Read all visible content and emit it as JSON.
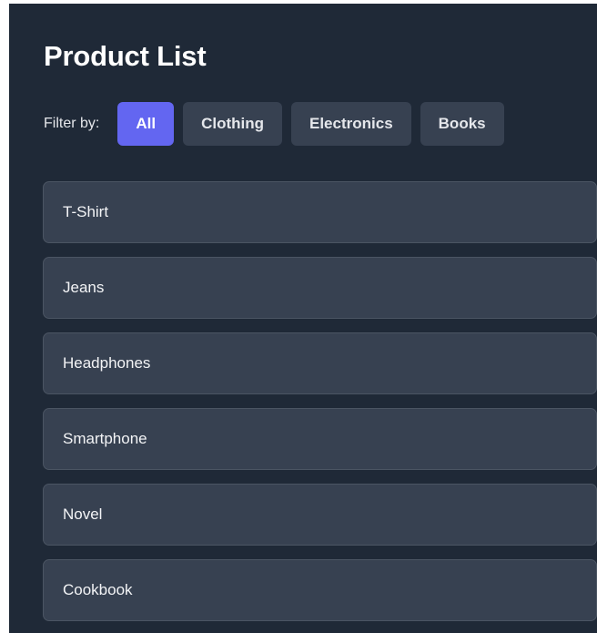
{
  "page": {
    "title": "Product List"
  },
  "filters": {
    "label": "Filter by:",
    "options": [
      {
        "label": "All",
        "active": true
      },
      {
        "label": "Clothing",
        "active": false
      },
      {
        "label": "Electronics",
        "active": false
      },
      {
        "label": "Books",
        "active": false
      }
    ]
  },
  "products": [
    {
      "name": "T-Shirt"
    },
    {
      "name": "Jeans"
    },
    {
      "name": "Headphones"
    },
    {
      "name": "Smartphone"
    },
    {
      "name": "Novel"
    },
    {
      "name": "Cookbook"
    }
  ],
  "colors": {
    "panel_background": "#1f2937",
    "item_background": "#374151",
    "accent": "#6366f1"
  }
}
